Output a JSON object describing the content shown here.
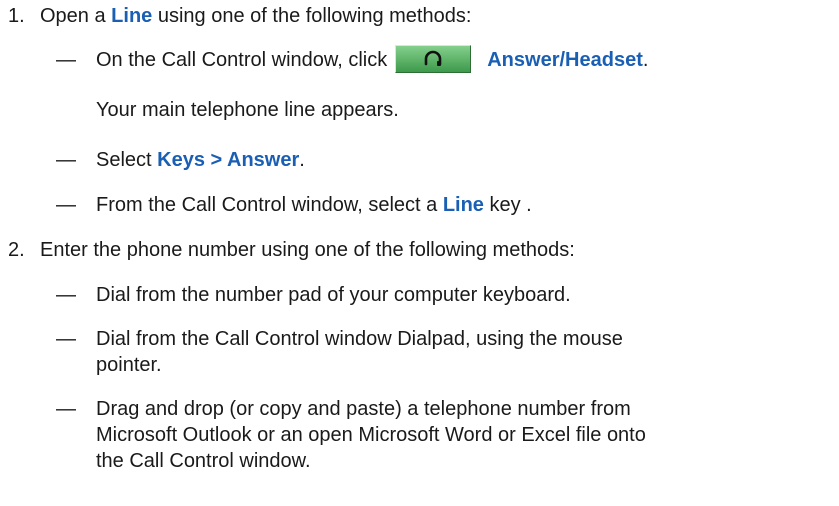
{
  "steps": [
    {
      "number": "1.",
      "intro": "Open a ",
      "intro_bold": "Line",
      "intro_rest": " using one of the following methods:",
      "methods": [
        {
          "dash": "—",
          "text_before": "On the Call Control window, click",
          "button_icon": "headset-icon",
          "bold": "Answer/Headset",
          "text_after": ".",
          "note": "Your main telephone line appears."
        },
        {
          "dash": "—",
          "text_before": "Select ",
          "bold": "Keys > Answer",
          "text_after": "."
        },
        {
          "dash": "—",
          "text_before": "From the Call Control window, select a ",
          "bold": "Line",
          "text_after": " key ."
        }
      ]
    },
    {
      "number": "2.",
      "intro": "Enter the phone number using one of the following methods:",
      "methods": [
        {
          "dash": "—",
          "text": "Dial from the number pad of your computer keyboard."
        },
        {
          "dash": "—",
          "text_line1": "Dial from the Call Control window Dialpad, using the mouse",
          "text_line2": "pointer."
        },
        {
          "dash": "—",
          "text_line1": "Drag and drop (or copy and paste) a telephone number from",
          "text_line2": "Microsoft Outlook or an open Microsoft Word or Excel file onto",
          "text_line3": "the Call Control window."
        }
      ]
    }
  ],
  "colors": {
    "link": "#1a5fb4",
    "button": "#4fae5c"
  }
}
